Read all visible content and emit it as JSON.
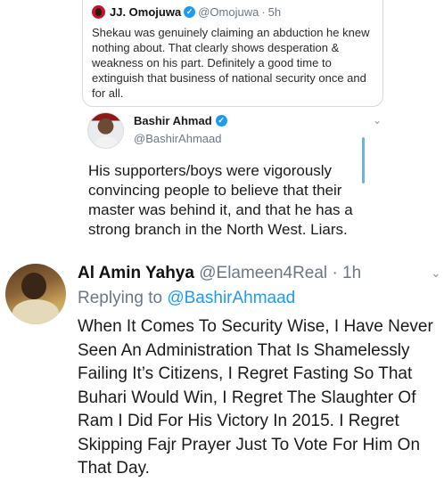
{
  "quoted_tweet": {
    "name": "JJ. Omojuwa",
    "handle": "@Omojuwa",
    "separator": "·",
    "time": "5h",
    "text": "Shekau was genuinely claiming an abduction he knew nothing about. That clearly shows desperation & weakness on his part. Definitely a good time to extinguish that business of national security once and for all."
  },
  "reply_tweet": {
    "name": "Bashir Ahmad",
    "handle": "@BashirAhmaad",
    "text": "His supporters/boys were vigorously convincing people to believe that their master was behind it, and that he has a strong branch in the North West. Liars."
  },
  "main_tweet": {
    "name": "Al Amin Yahya",
    "handle": "@Elameen4Real",
    "separator": "·",
    "time": "1h",
    "replying_prefix": "Replying to",
    "replying_to": "@BashirAhmaad",
    "text": "When It Comes To Security Wise, I Have Never Seen An Administration That Is Shamelessly Failing It’s Citizens, I Regret Fasting So That Buhari Would Win, I Regret The Slaughter Of Ram I Did For His Victory In 2015. I Regret Skipping Fajr Prayer Just To Vote For Him On That Day."
  },
  "icons": {
    "verified": "✓",
    "chevron": "⌄"
  },
  "colors": {
    "link": "#1d9bf0",
    "verified": "#1d9bf0",
    "muted": "#6b7785"
  }
}
